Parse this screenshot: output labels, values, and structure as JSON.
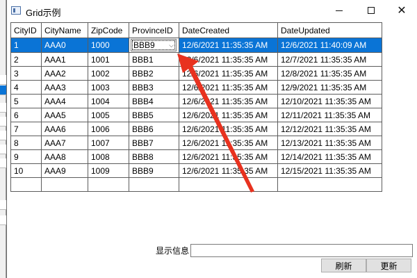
{
  "window": {
    "title": "Grid示例",
    "icon": "app-window-icon"
  },
  "grid": {
    "headers": [
      "CityID",
      "CityName",
      "ZipCode",
      "ProvinceID",
      "DateCreated",
      "DateUpdated"
    ],
    "rows": [
      [
        "1",
        "AAA0",
        "1000",
        "BBB9",
        "12/6/2021 11:35:35 AM",
        "12/6/2021 11:40:09 AM"
      ],
      [
        "2",
        "AAA1",
        "1001",
        "BBB1",
        "12/6/2021 11:35:35 AM",
        "12/7/2021 11:35:35 AM"
      ],
      [
        "3",
        "AAA2",
        "1002",
        "BBB2",
        "12/6/2021 11:35:35 AM",
        "12/8/2021 11:35:35 AM"
      ],
      [
        "4",
        "AAA3",
        "1003",
        "BBB3",
        "12/6/2021 11:35:35 AM",
        "12/9/2021 11:35:35 AM"
      ],
      [
        "5",
        "AAA4",
        "1004",
        "BBB4",
        "12/6/2021 11:35:35 AM",
        "12/10/2021 11:35:35 AM"
      ],
      [
        "6",
        "AAA5",
        "1005",
        "BBB5",
        "12/6/2021 11:35:35 AM",
        "12/11/2021 11:35:35 AM"
      ],
      [
        "7",
        "AAA6",
        "1006",
        "BBB6",
        "12/6/2021 11:35:35 AM",
        "12/12/2021 11:35:35 AM"
      ],
      [
        "8",
        "AAA7",
        "1007",
        "BBB7",
        "12/6/2021 11:35:35 AM",
        "12/13/2021 11:35:35 AM"
      ],
      [
        "9",
        "AAA8",
        "1008",
        "BBB8",
        "12/6/2021 11:35:35 AM",
        "12/14/2021 11:35:35 AM"
      ],
      [
        "10",
        "AAA9",
        "1009",
        "BBB9",
        "12/6/2021 11:35:35 AM",
        "12/15/2021 11:35:35 AM"
      ]
    ],
    "selected_row": 0,
    "editing_cell": {
      "row": 0,
      "column": 3
    },
    "combo_caret_icon": "chevron-down-icon"
  },
  "footer": {
    "info_label": "显示信息",
    "info_value": "",
    "refresh_label": "刷新",
    "update_label": "更新"
  },
  "colors": {
    "selection": "#0a74d6",
    "annotation_arrow": "#e8321f"
  }
}
